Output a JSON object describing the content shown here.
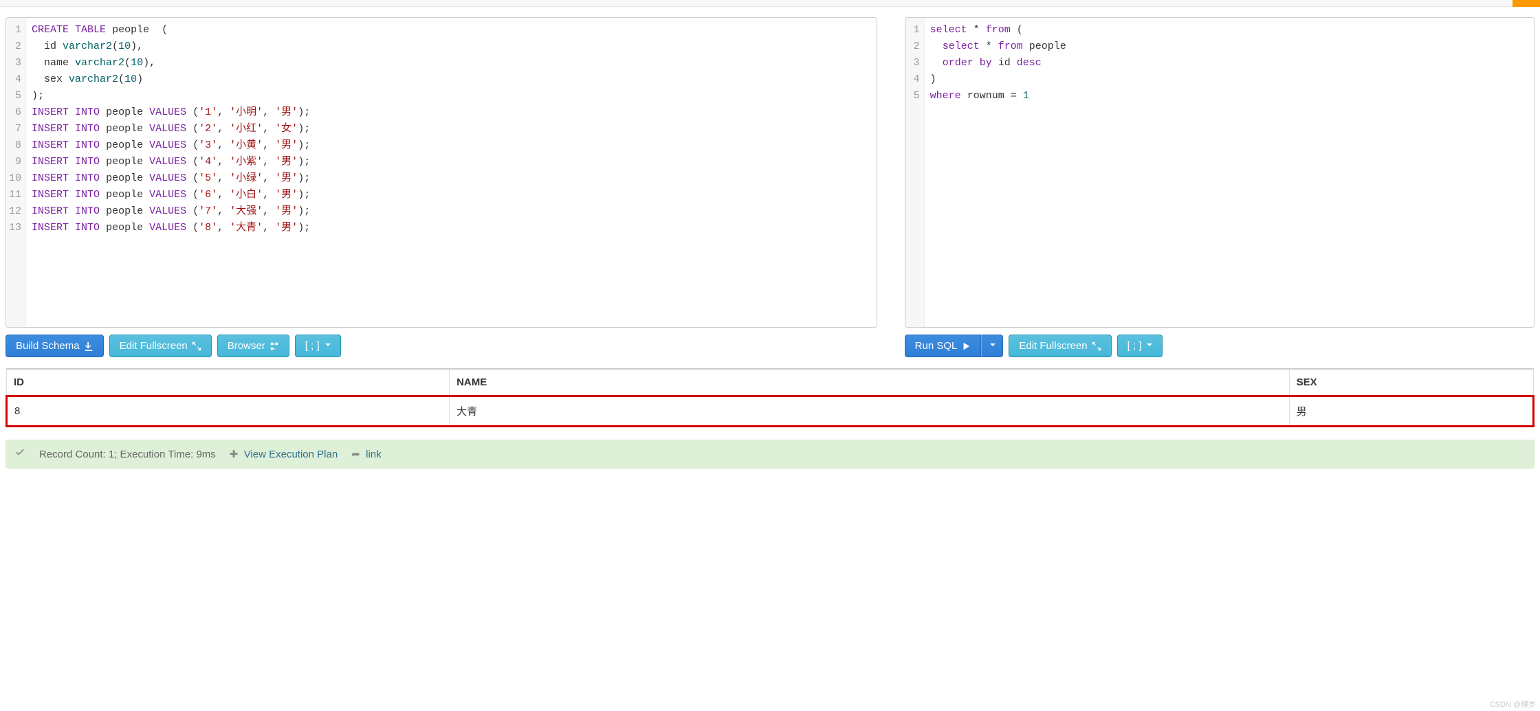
{
  "schemaEditor": {
    "lines": [
      {
        "n": 1,
        "html": "<span class='kw'>CREATE</span> <span class='kw'>TABLE</span> people  ("
      },
      {
        "n": 2,
        "html": "  id <span class='fn'>varchar2</span>(<span class='num'>10</span>),"
      },
      {
        "n": 3,
        "html": "  name <span class='fn'>varchar2</span>(<span class='num'>10</span>),"
      },
      {
        "n": 4,
        "html": "  sex <span class='fn'>varchar2</span>(<span class='num'>10</span>)"
      },
      {
        "n": 5,
        "html": ");"
      },
      {
        "n": 6,
        "html": "<span class='kw'>INSERT</span> <span class='kw'>INTO</span> people <span class='kw'>VALUES</span> (<span class='str'>'1'</span>, <span class='str'>'小明'</span>, <span class='str'>'男'</span>);"
      },
      {
        "n": 7,
        "html": "<span class='kw'>INSERT</span> <span class='kw'>INTO</span> people <span class='kw'>VALUES</span> (<span class='str'>'2'</span>, <span class='str'>'小红'</span>, <span class='str'>'女'</span>);"
      },
      {
        "n": 8,
        "html": "<span class='kw'>INSERT</span> <span class='kw'>INTO</span> people <span class='kw'>VALUES</span> (<span class='str'>'3'</span>, <span class='str'>'小黄'</span>, <span class='str'>'男'</span>);"
      },
      {
        "n": 9,
        "html": "<span class='kw'>INSERT</span> <span class='kw'>INTO</span> people <span class='kw'>VALUES</span> (<span class='str'>'4'</span>, <span class='str'>'小紫'</span>, <span class='str'>'男'</span>);"
      },
      {
        "n": 10,
        "html": "<span class='kw'>INSERT</span> <span class='kw'>INTO</span> people <span class='kw'>VALUES</span> (<span class='str'>'5'</span>, <span class='str'>'小绿'</span>, <span class='str'>'男'</span>);"
      },
      {
        "n": 11,
        "html": "<span class='kw'>INSERT</span> <span class='kw'>INTO</span> people <span class='kw'>VALUES</span> (<span class='str'>'6'</span>, <span class='str'>'小白'</span>, <span class='str'>'男'</span>);"
      },
      {
        "n": 12,
        "html": "<span class='kw'>INSERT</span> <span class='kw'>INTO</span> people <span class='kw'>VALUES</span> (<span class='str'>'7'</span>, <span class='str'>'大强'</span>, <span class='str'>'男'</span>);"
      },
      {
        "n": 13,
        "html": "<span class='kw'>INSERT</span> <span class='kw'>INTO</span> people <span class='kw'>VALUES</span> (<span class='str'>'8'</span>, <span class='str'>'大青'</span>, <span class='str'>'男'</span>);"
      }
    ]
  },
  "queryEditor": {
    "lines": [
      {
        "n": 1,
        "html": "<span class='kw'>select</span> * <span class='kw'>from</span> ("
      },
      {
        "n": 2,
        "html": "  <span class='kw'>select</span> * <span class='kw'>from</span> people"
      },
      {
        "n": 3,
        "html": "  <span class='kw'>order</span> <span class='kw'>by</span> id <span class='kw'>desc</span>"
      },
      {
        "n": 4,
        "html": ")"
      },
      {
        "n": 5,
        "html": "<span class='kw'>where</span> rownum = <span class='num'>1</span>"
      }
    ]
  },
  "buttons": {
    "buildSchema": "Build Schema",
    "editFullscreen": "Edit Fullscreen",
    "browser": "Browser",
    "format": "[ ; ]",
    "runSql": "Run SQL"
  },
  "result": {
    "headers": [
      "ID",
      "NAME",
      "SEX"
    ],
    "rows": [
      [
        "8",
        "大青",
        "男"
      ]
    ]
  },
  "status": {
    "text": "Record Count: 1; Execution Time: 9ms",
    "viewPlan": "View Execution Plan",
    "link": "link"
  },
  "watermark": "CSDN @博岁"
}
